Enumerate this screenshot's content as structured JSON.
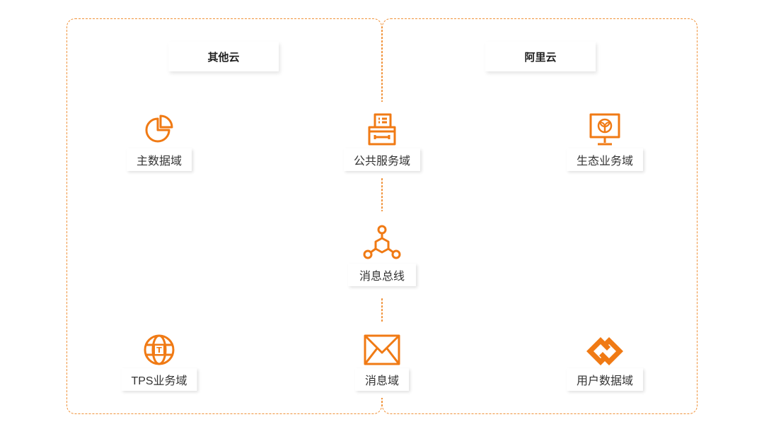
{
  "regions": {
    "left": {
      "title": "其他云"
    },
    "right": {
      "title": "阿里云"
    }
  },
  "nodes": {
    "master_data": {
      "label": "主数据域",
      "icon": "pie-chart-icon"
    },
    "public_service": {
      "label": "公共服务域",
      "icon": "fax-printer-icon"
    },
    "ecosystem": {
      "label": "生态业务域",
      "icon": "monitor-sprout-icon"
    },
    "message_bus": {
      "label": "消息总线",
      "icon": "network-nodes-icon"
    },
    "tps": {
      "label": "TPS业务域",
      "icon": "globe-icon"
    },
    "message": {
      "label": "消息域",
      "icon": "envelope-icon"
    },
    "user_data": {
      "label": "用户数据域",
      "icon": "linked-diamonds-icon"
    }
  },
  "colors": {
    "accent": "#f07a14",
    "border": "#f0923a",
    "text": "#333333"
  }
}
